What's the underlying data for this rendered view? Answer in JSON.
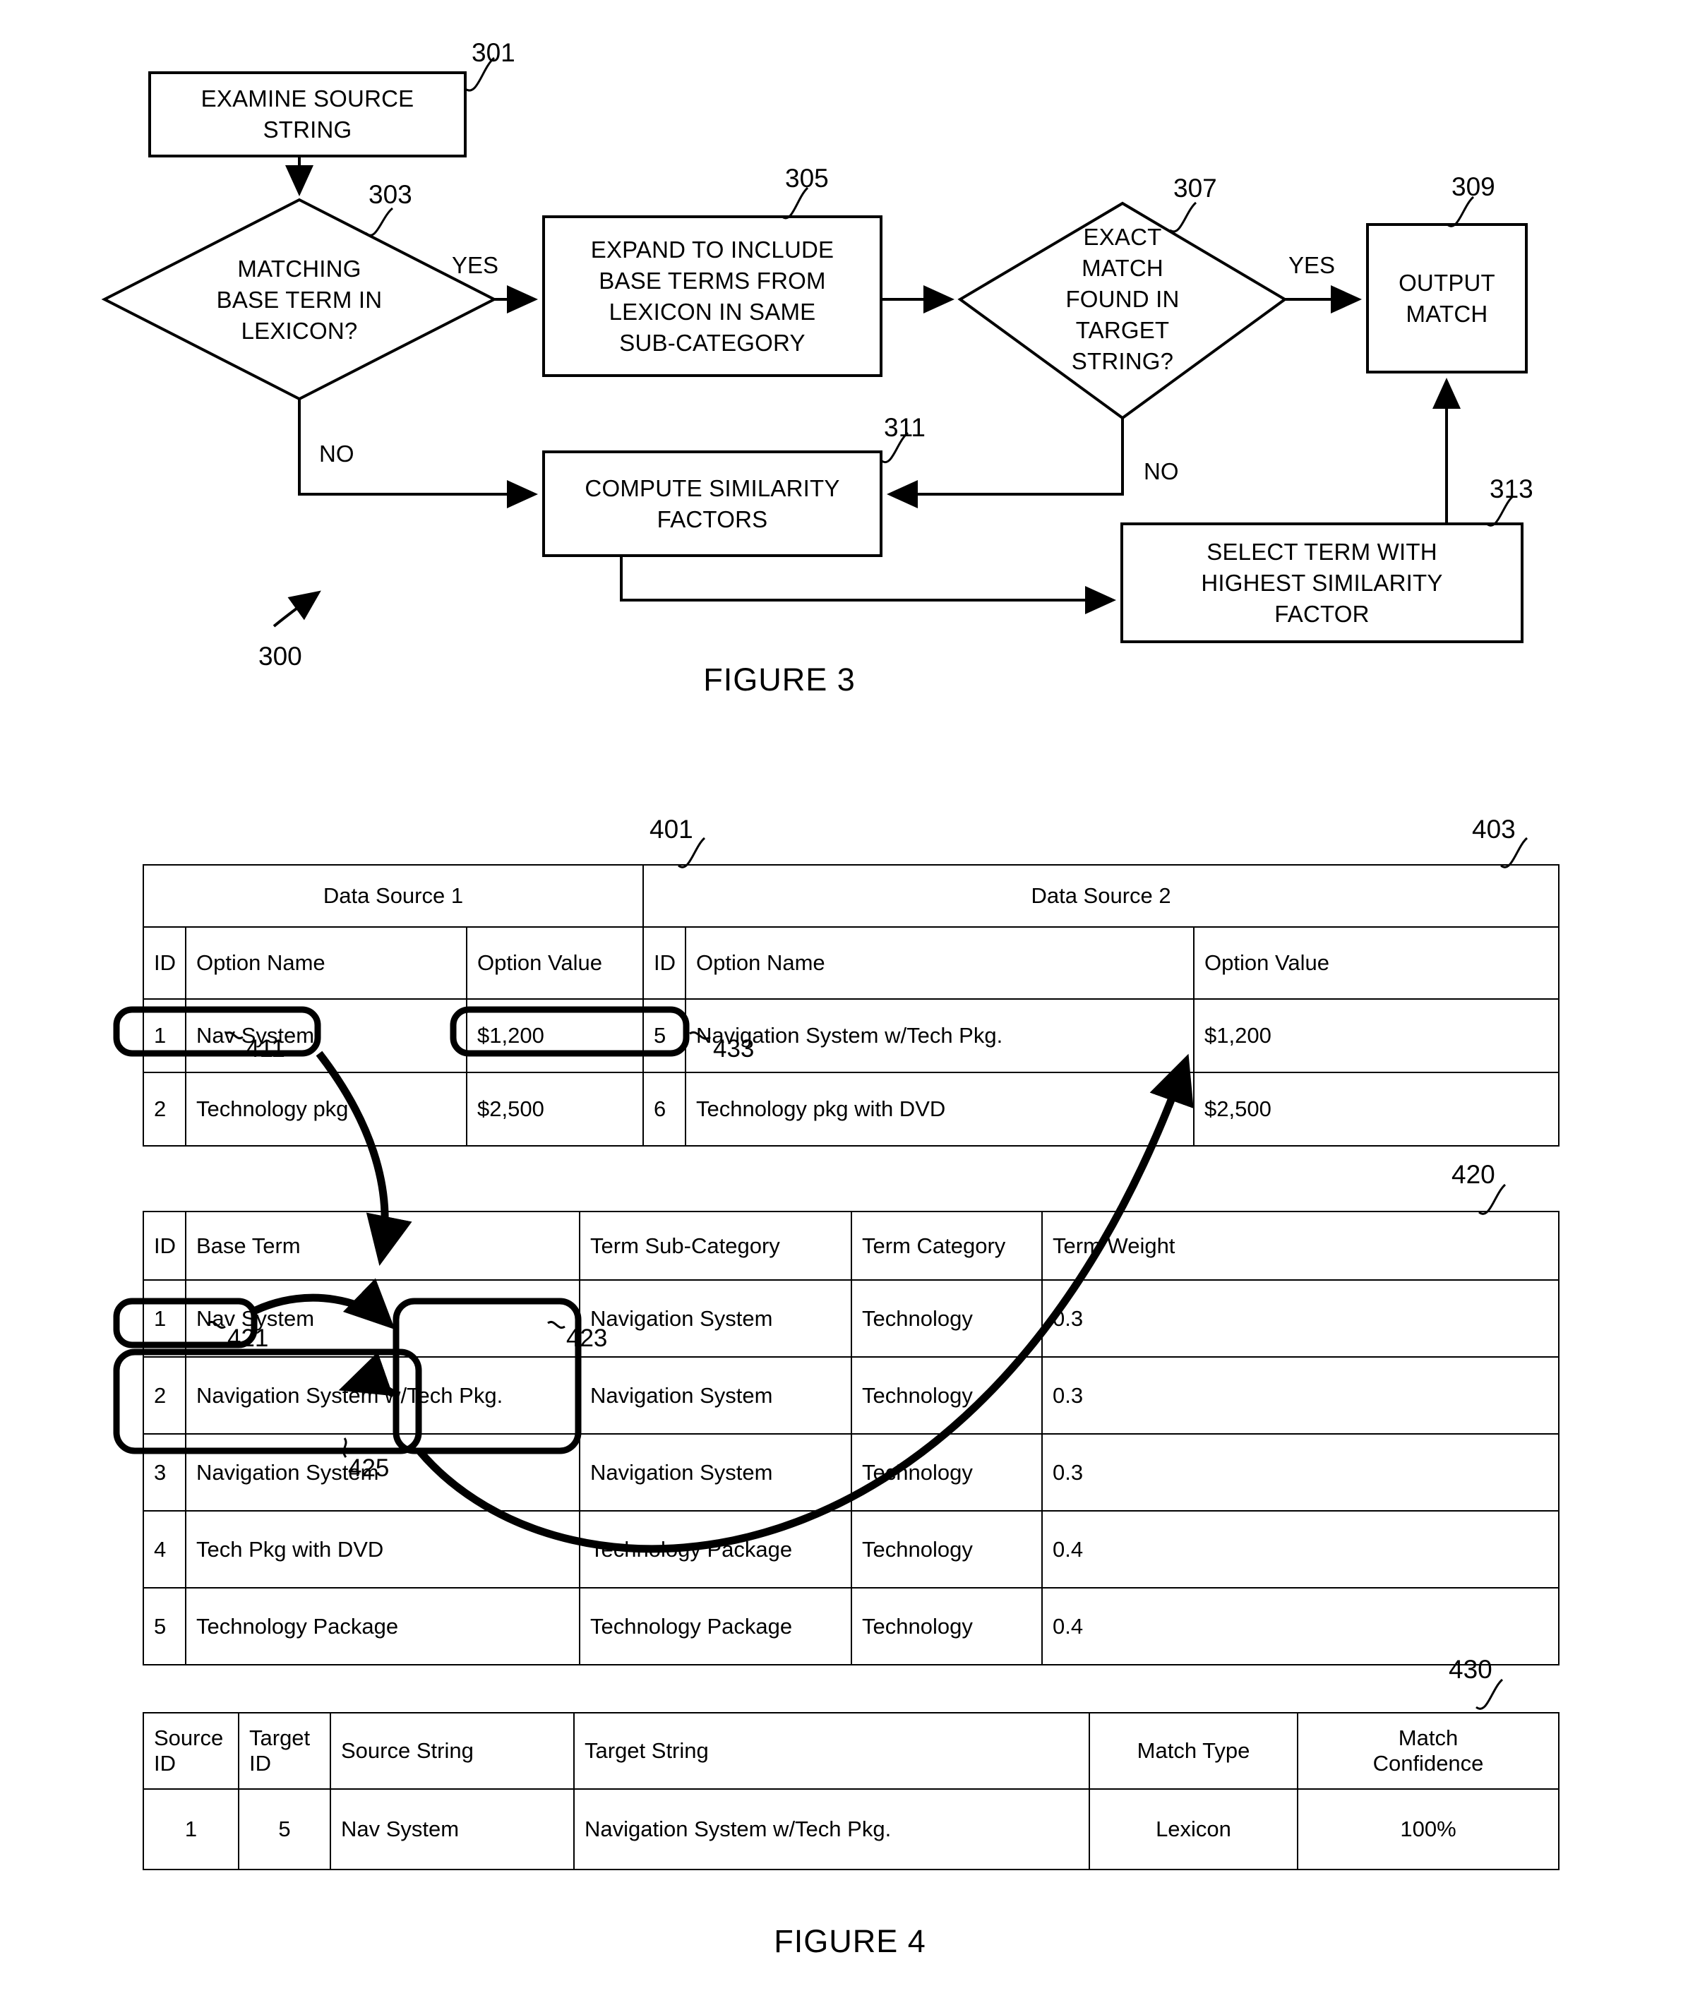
{
  "figure3": {
    "caption": "FIGURE 3",
    "diagram_ref": "300",
    "nodes": [
      {
        "id": "301",
        "ref": "301",
        "type": "process",
        "text": "EXAMINE SOURCE\nSTRING"
      },
      {
        "id": "303",
        "ref": "303",
        "type": "decision",
        "text": "MATCHING\nBASE TERM IN\nLEXICON?"
      },
      {
        "id": "305",
        "ref": "305",
        "type": "process",
        "text": "EXPAND TO INCLUDE\nBASE TERMS FROM\nLEXICON IN SAME\nSUB-CATEGORY"
      },
      {
        "id": "307",
        "ref": "307",
        "type": "decision",
        "text": "EXACT\nMATCH\nFOUND IN\nTARGET\nSTRING?"
      },
      {
        "id": "309",
        "ref": "309",
        "type": "process",
        "text": "OUTPUT\nMATCH"
      },
      {
        "id": "311",
        "ref": "311",
        "type": "process",
        "text": "COMPUTE SIMILARITY\nFACTORS"
      },
      {
        "id": "313",
        "ref": "313",
        "type": "process",
        "text": "SELECT TERM WITH\nHIGHEST SIMILARITY\nFACTOR"
      }
    ],
    "edge_labels": {
      "yes_303": "YES",
      "no_303": "NO",
      "yes_307": "YES",
      "no_307": "NO"
    }
  },
  "figure4": {
    "caption": "FIGURE 4",
    "source_tables": {
      "ref_left": "401",
      "ref_right": "403",
      "group_headers": [
        "Data Source 1",
        "Data Source 2"
      ],
      "columns": [
        "ID",
        "Option Name",
        "Option Value",
        "ID",
        "Option Name",
        "Option Value"
      ],
      "rows": [
        [
          "1",
          "Nav System",
          "$1,200",
          "5",
          "Navigation System w/Tech Pkg.",
          "$1,200"
        ],
        [
          "2",
          "Technology pkg",
          "$2,500",
          "6",
          "Technology pkg with DVD",
          "$2,500"
        ]
      ],
      "callouts": {
        "left_cell": "411",
        "right_cell": "433"
      }
    },
    "lexicon_table": {
      "ref": "420",
      "columns": [
        "ID",
        "Base Term",
        "Term Sub-Category",
        "Term Category",
        "Term Weight"
      ],
      "rows": [
        [
          "1",
          "Nav System",
          "Navigation System",
          "Technology",
          "0.3"
        ],
        [
          "2",
          "Navigation System w/Tech Pkg.",
          "Navigation System",
          "Technology",
          "0.3"
        ],
        [
          "3",
          "Navigation System",
          "Navigation System",
          "Technology",
          "0.3"
        ],
        [
          "4",
          "Tech Pkg with DVD",
          "Technology Package",
          "Technology",
          "0.4"
        ],
        [
          "5",
          "Technology Package",
          "Technology Package",
          "Technology",
          "0.4"
        ]
      ],
      "callouts": {
        "base_term_row1": "421",
        "sub_category_group": "423",
        "base_term_group": "425"
      }
    },
    "match_table": {
      "ref": "430",
      "columns": [
        "Source\nID",
        "Target\nID",
        "Source String",
        "Target String",
        "Match Type",
        "Match\nConfidence"
      ],
      "rows": [
        [
          "1",
          "5",
          "Nav System",
          "Navigation System w/Tech Pkg.",
          "Lexicon",
          "100%"
        ]
      ]
    }
  }
}
